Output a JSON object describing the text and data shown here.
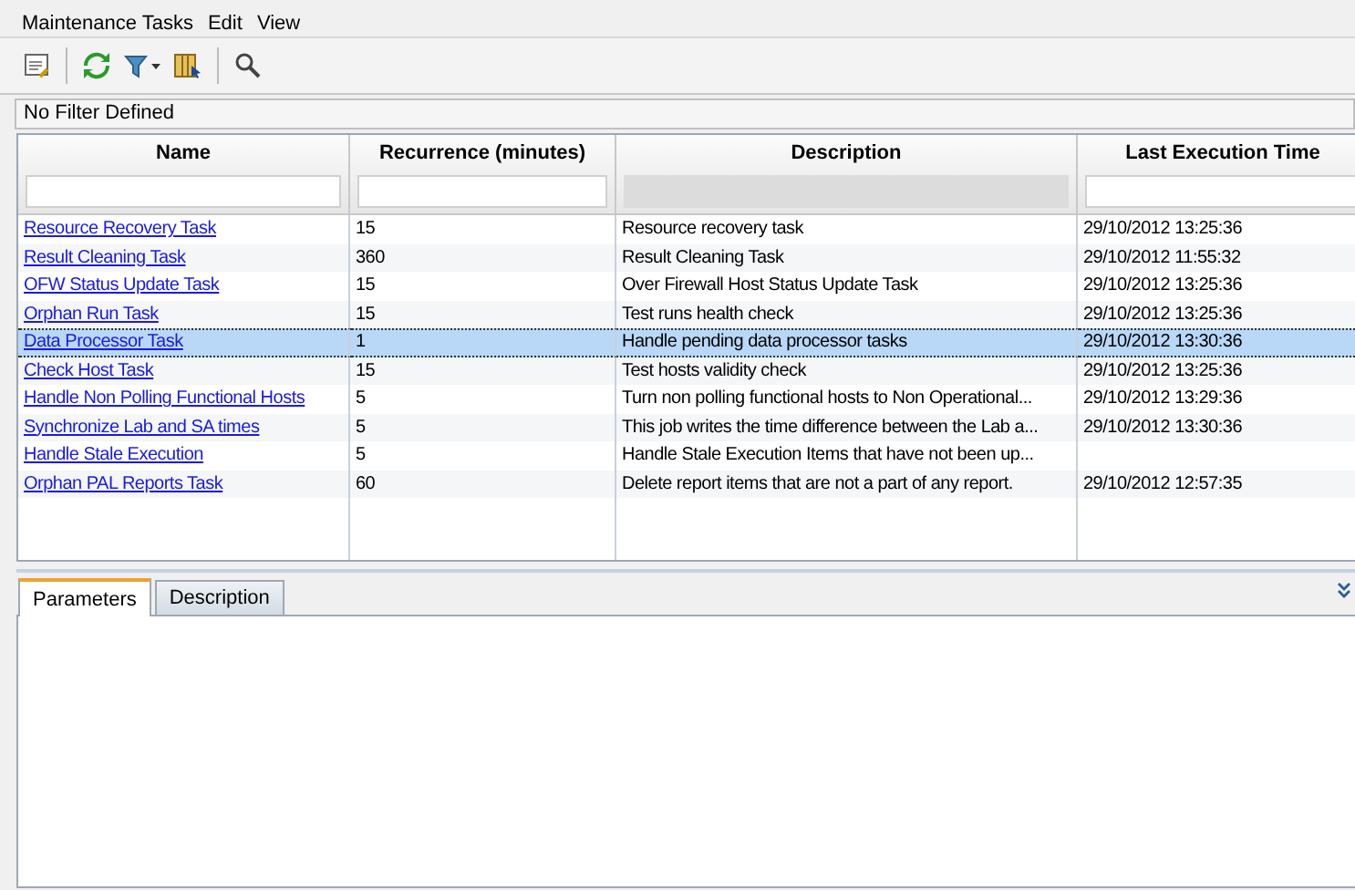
{
  "menu": [
    "Maintenance Tasks",
    "Edit",
    "View"
  ],
  "filter_status": "No Filter Defined",
  "table": {
    "columns": [
      {
        "label": "Name",
        "filter_enabled": true
      },
      {
        "label": "Recurrence (minutes)",
        "filter_enabled": true
      },
      {
        "label": "Description",
        "filter_enabled": false
      },
      {
        "label": "Last Execution Time",
        "filter_enabled": true
      }
    ],
    "rows": [
      {
        "name": "Resource Recovery Task",
        "recurrence": "15",
        "description": "Resource recovery task",
        "last_execution": "29/10/2012 13:25:36",
        "selected": false
      },
      {
        "name": "Result Cleaning Task",
        "recurrence": "360",
        "description": "Result Cleaning Task",
        "last_execution": "29/10/2012 11:55:32",
        "selected": false
      },
      {
        "name": "OFW Status Update Task",
        "recurrence": "15",
        "description": "Over Firewall Host Status Update Task",
        "last_execution": "29/10/2012 13:25:36",
        "selected": false
      },
      {
        "name": "Orphan Run Task",
        "recurrence": "15",
        "description": "Test runs health check",
        "last_execution": "29/10/2012 13:25:36",
        "selected": false
      },
      {
        "name": "Data Processor Task",
        "recurrence": "1",
        "description": "Handle pending data processor tasks",
        "last_execution": "29/10/2012 13:30:36",
        "selected": true
      },
      {
        "name": "Check Host Task",
        "recurrence": "15",
        "description": "Test hosts validity check",
        "last_execution": "29/10/2012 13:25:36",
        "selected": false
      },
      {
        "name": "Handle Non Polling Functional Hosts",
        "recurrence": "5",
        "description": "Turn non polling functional hosts to Non Operational...",
        "last_execution": "29/10/2012 13:29:36",
        "selected": false
      },
      {
        "name": "Synchronize Lab and SA times",
        "recurrence": "5",
        "description": "This job writes the time difference between the Lab a...",
        "last_execution": "29/10/2012 13:30:36",
        "selected": false
      },
      {
        "name": "Handle Stale Execution",
        "recurrence": "5",
        "description": "Handle Stale Execution Items that have not been up...",
        "selected": false
      },
      {
        "name": "Orphan PAL Reports Task",
        "recurrence": "60",
        "description": "Delete report items that are not a part of any report.",
        "last_execution": "29/10/2012 12:57:35",
        "selected": false
      }
    ]
  },
  "tabs": [
    {
      "label": "Parameters",
      "selected": true
    },
    {
      "label": "Description",
      "selected": false
    }
  ]
}
